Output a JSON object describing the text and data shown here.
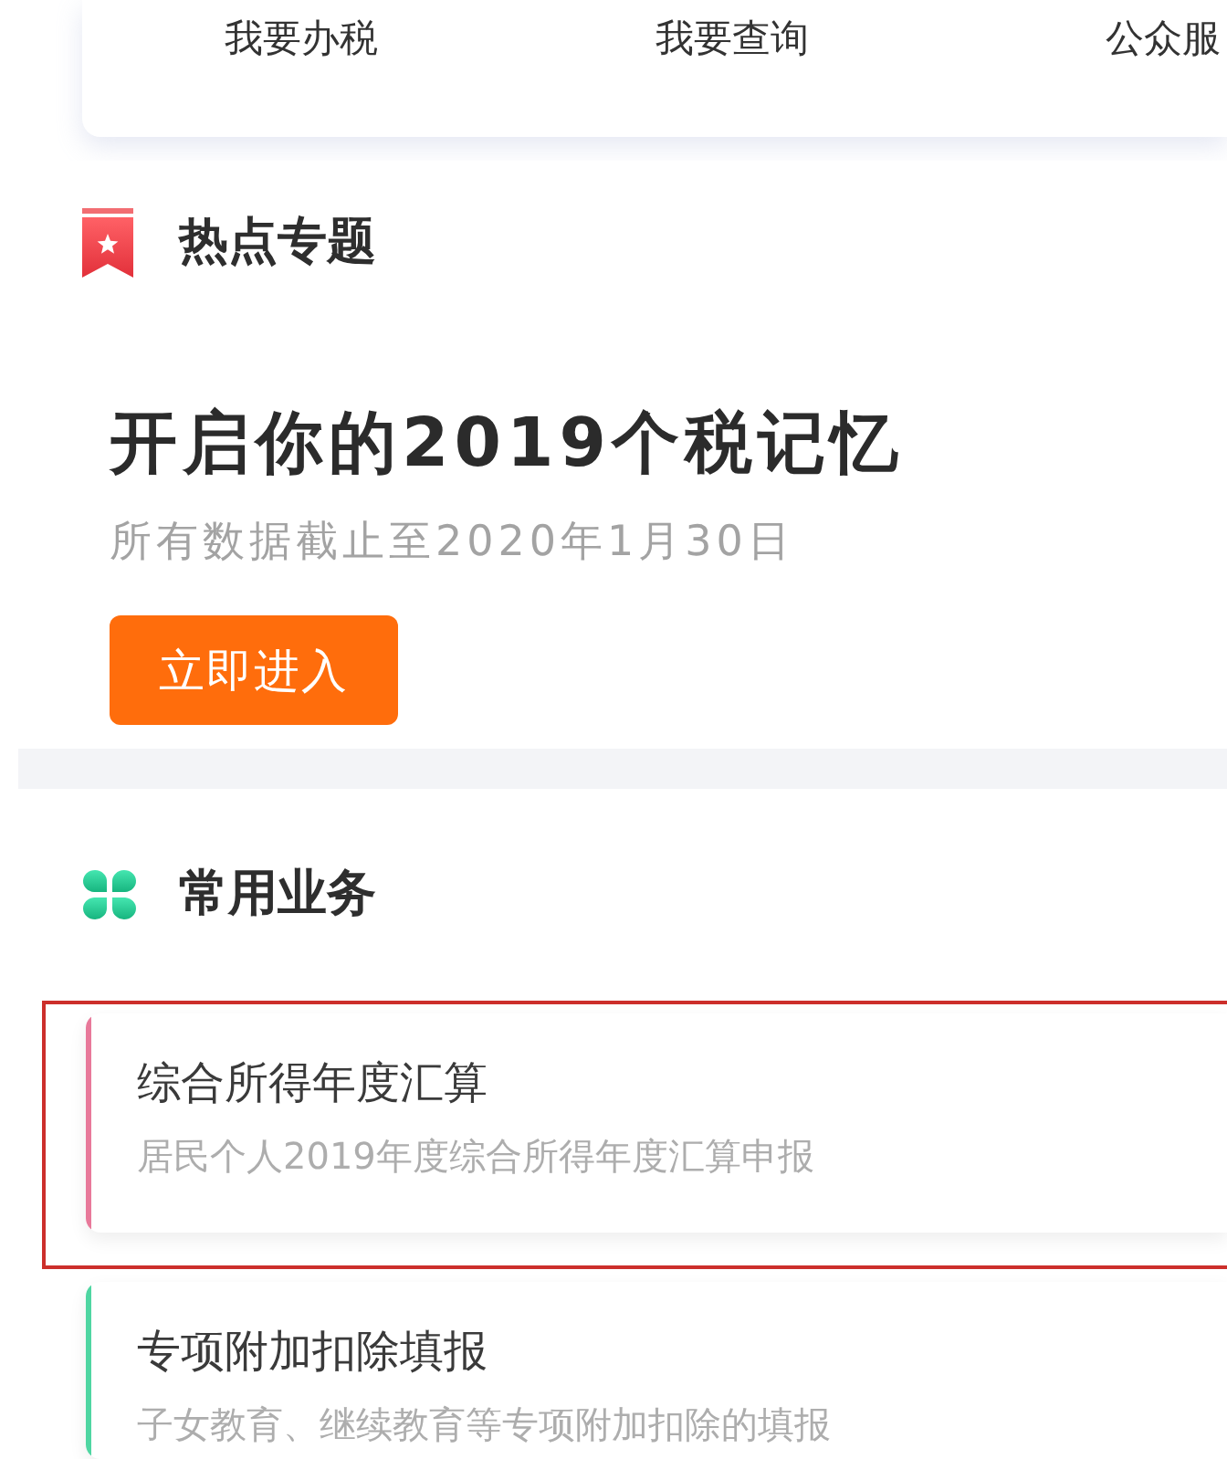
{
  "nav": {
    "items": [
      "我要办税",
      "我要查询",
      "公众服"
    ]
  },
  "hot_topics": {
    "title": "热点专题",
    "headline": "开启你的2019个税记忆",
    "note": "所有数据截止至2020年1月30日",
    "button": "立即进入"
  },
  "common_services": {
    "title": "常用业务",
    "items": [
      {
        "title": "综合所得年度汇算",
        "subtitle": "居民个人2019年度综合所得年度汇算申报",
        "color": "#e8799a",
        "highlighted": true
      },
      {
        "title": "专项附加扣除填报",
        "subtitle": "子女教育、继续教育等专项附加扣除的填报",
        "color": "#4fd6a2",
        "highlighted": false
      }
    ]
  }
}
